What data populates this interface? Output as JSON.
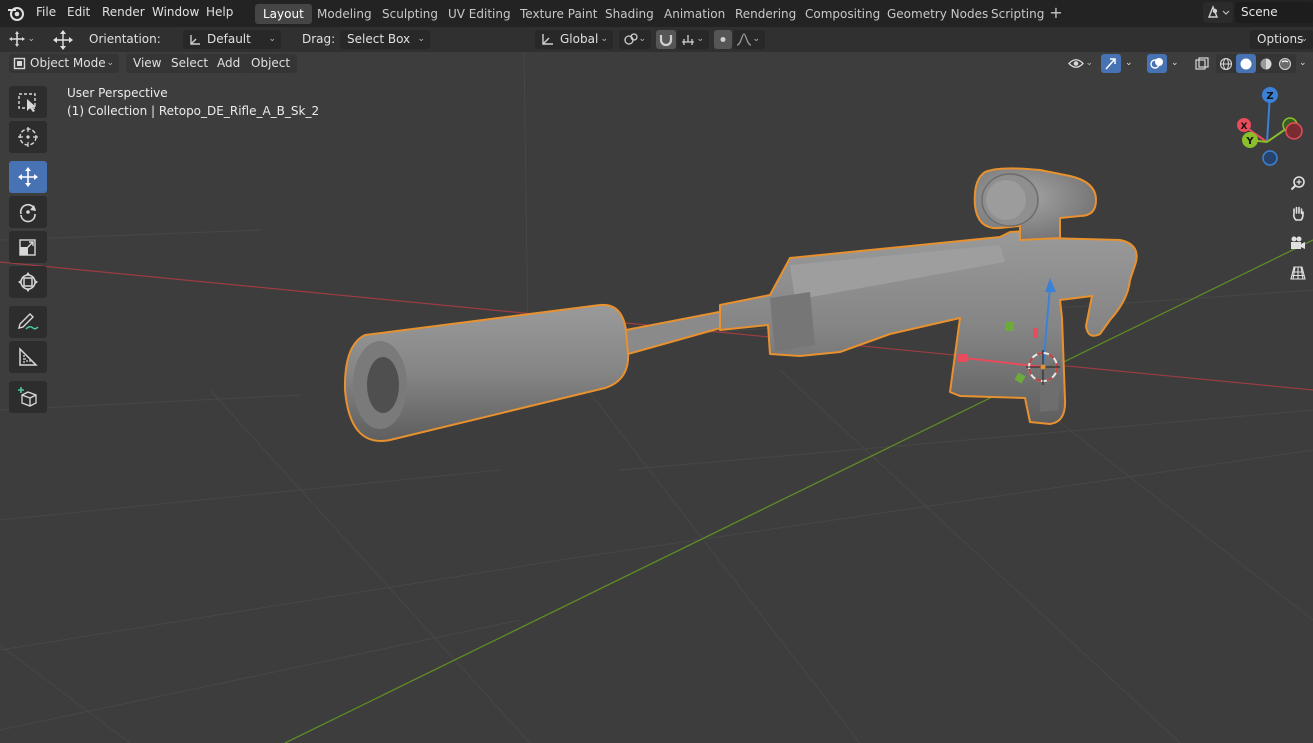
{
  "menu": [
    "File",
    "Edit",
    "Render",
    "Window",
    "Help"
  ],
  "workspaces": [
    {
      "label": "Layout",
      "active": true
    },
    {
      "label": "Modeling"
    },
    {
      "label": "Sculpting"
    },
    {
      "label": "UV Editing"
    },
    {
      "label": "Texture Paint"
    },
    {
      "label": "Shading"
    },
    {
      "label": "Animation"
    },
    {
      "label": "Rendering"
    },
    {
      "label": "Compositing"
    },
    {
      "label": "Geometry Nodes"
    },
    {
      "label": "Scripting"
    }
  ],
  "scene": {
    "label": "Scene"
  },
  "header": {
    "orientation_label": "Orientation:",
    "orientation_value": "Default",
    "drag_label": "Drag:",
    "drag_value": "Select Box",
    "transform_orientation": "Global",
    "options_label": "Options"
  },
  "viewport_header": {
    "mode": "Object Mode",
    "menus": [
      "View",
      "Select",
      "Add",
      "Object"
    ]
  },
  "viewport": {
    "perspective_label": "User Perspective",
    "collection_label": "(1) Collection | Retopo_DE_Rifle_A_B_Sk_2"
  },
  "gizmo": {
    "z_label": "Z",
    "y_label": "Y",
    "x_label": "X",
    "colors": {
      "x": "#e84c5b",
      "y": "#8bbf2a",
      "z": "#3b82d6"
    }
  },
  "tools": [
    {
      "name": "select-box-icon",
      "active": false
    },
    {
      "name": "cursor-icon",
      "active": false
    },
    {
      "name": "move-icon",
      "active": true
    },
    {
      "name": "rotate-icon",
      "active": false
    },
    {
      "name": "scale-icon",
      "active": false
    },
    {
      "name": "transform-icon",
      "active": false
    },
    {
      "name": "annotate-icon",
      "active": false
    },
    {
      "name": "measure-icon",
      "active": false
    },
    {
      "name": "add-cube-icon",
      "active": false
    }
  ],
  "colors": {
    "selection_outline": "#e7912f",
    "active_tool": "#4772b3",
    "x_axis": "#a83a3e",
    "y_axis": "#5d8a23"
  }
}
